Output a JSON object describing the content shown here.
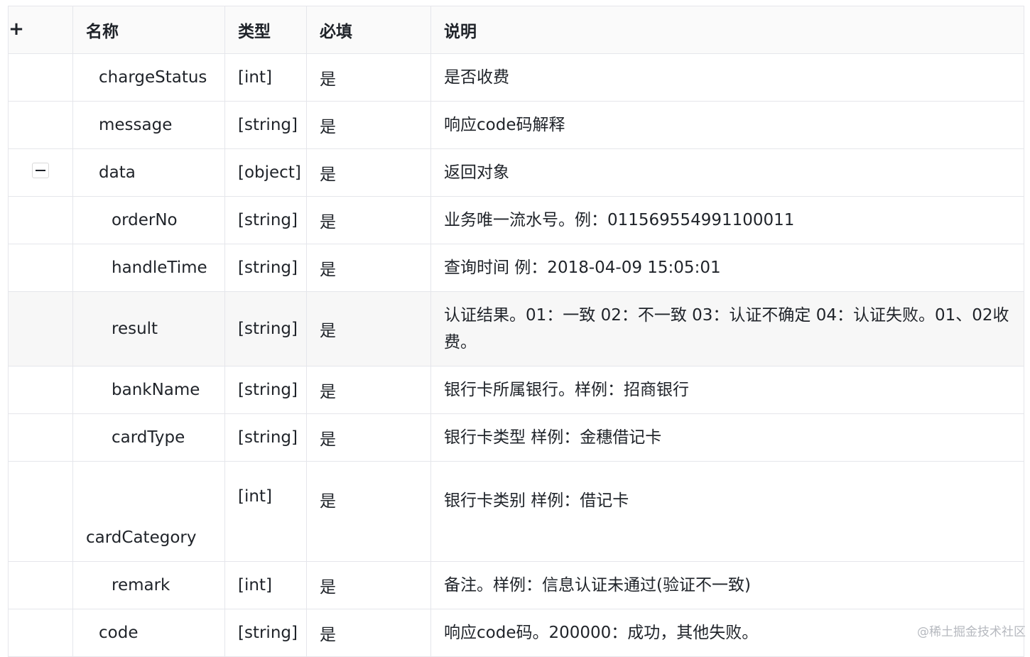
{
  "header": {
    "expand_icon": "+",
    "name": "名称",
    "type": "类型",
    "required": "必填",
    "description": "说明"
  },
  "rows": [
    {
      "name": "chargeStatus",
      "type": "[int]",
      "required": "是",
      "description": "是否收费"
    },
    {
      "name": "message",
      "type": "[string]",
      "required": "是",
      "description": "响应code码解释"
    },
    {
      "name": "data",
      "type": "[object]",
      "required": "是",
      "description": "返回对象"
    },
    {
      "name": "orderNo",
      "type": "[string]",
      "required": "是",
      "description": "业务唯一流水号。例：011569554991100011"
    },
    {
      "name": "handleTime",
      "type": "[string]",
      "required": "是",
      "description": "查询时间 例：2018-04-09 15:05:01"
    },
    {
      "name": "result",
      "type": "[string]",
      "required": "是",
      "description": "认证结果。01：一致 02：不一致 03：认证不确定 04：认证失败。01、02收费。"
    },
    {
      "name": "bankName",
      "type": "[string]",
      "required": "是",
      "description": "银行卡所属银行。样例：招商银行"
    },
    {
      "name": "cardType",
      "type": "[string]",
      "required": "是",
      "description": "银行卡类型 样例：金穗借记卡"
    },
    {
      "name": "cardCategory",
      "type": "[int]",
      "required": "是",
      "description": "银行卡类别 样例：借记卡"
    },
    {
      "name": "remark",
      "type": "[int]",
      "required": "是",
      "description": "备注。样例：信息认证未通过(验证不一致)"
    },
    {
      "name": "code",
      "type": "[string]",
      "required": "是",
      "description": "响应code码。200000：成功，其他失败。"
    }
  ],
  "watermark": "@稀土掘金技术社区"
}
